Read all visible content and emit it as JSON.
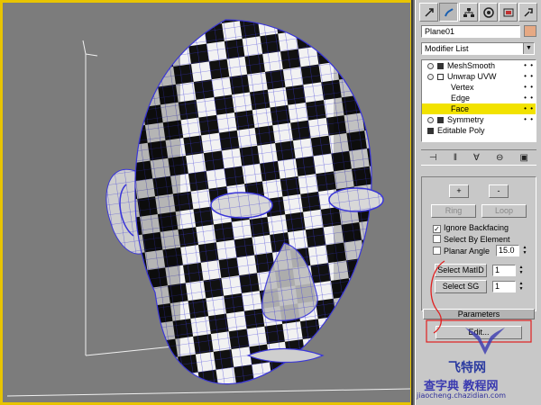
{
  "panel": {
    "tabs": [
      "create-icon",
      "modify-icon",
      "hierarchy-icon",
      "motion-icon",
      "display-icon",
      "utilities-icon"
    ],
    "object_name": "Plane01",
    "object_color": "#e6a984",
    "modifier_list_label": "Modifier List",
    "stack": [
      {
        "label": "MeshSmooth",
        "level": 0,
        "selected": false
      },
      {
        "label": "Unwrap UVW",
        "level": 0,
        "selected": false
      },
      {
        "label": "Vertex",
        "level": 1,
        "selected": false
      },
      {
        "label": "Edge",
        "level": 1,
        "selected": false
      },
      {
        "label": "Face",
        "level": 1,
        "selected": true
      },
      {
        "label": "Symmetry",
        "level": 0,
        "selected": false
      },
      {
        "label": "Editable Poly",
        "level": 0,
        "selected": false
      }
    ],
    "selection": {
      "grow_label": "+",
      "shrink_label": "-",
      "ring_label": "Ring",
      "loop_label": "Loop",
      "ignore_backfacing_label": "Ignore Backfacing",
      "ignore_backfacing_checked": "✓",
      "select_by_element_label": "Select By Element",
      "planar_angle_label": "Planar Angle",
      "planar_angle_value": "15.0",
      "select_matid_label": "Select MatID",
      "matid_value": "1",
      "select_sg_label": "Select SG",
      "sg_value": "1"
    },
    "parameters_label": "Parameters",
    "edit_label": "Edit..."
  },
  "watermark": {
    "brand": "飞特网",
    "site": "查字典 教程网",
    "url": "jiaocheng.chazidian.com"
  },
  "colors": {
    "selection_yellow": "#f2e200",
    "wire_blue": "#3a36d8",
    "viewport_border": "#e8c400",
    "annotation_red": "#e02020"
  }
}
